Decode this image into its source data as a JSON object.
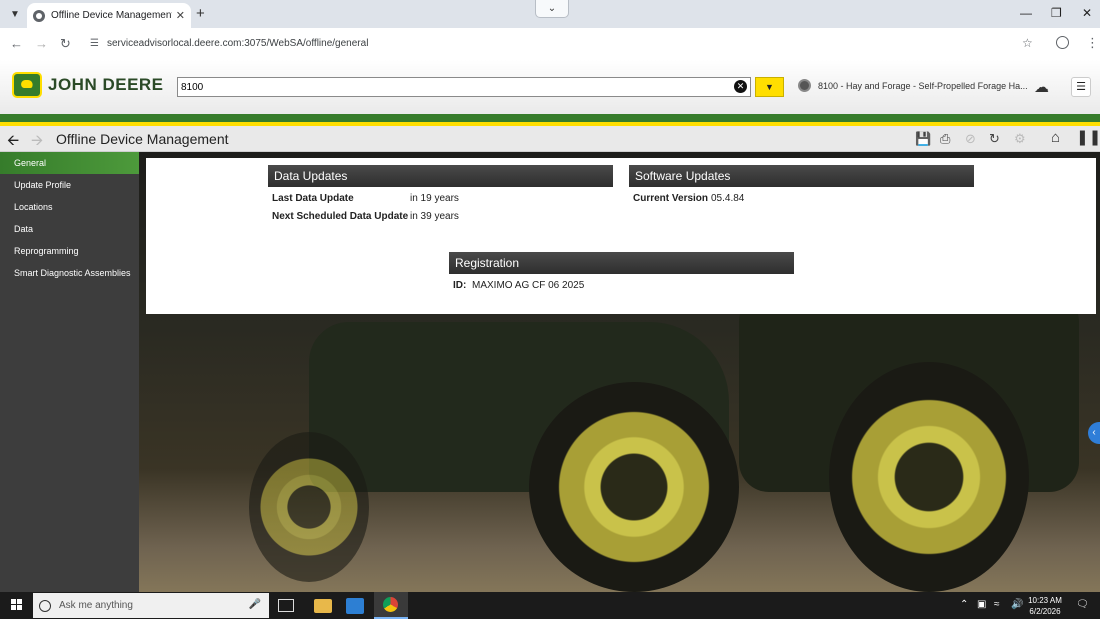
{
  "browser": {
    "tab_title": "Offline Device Management :: S",
    "url": "serviceadvisorlocal.deere.com:3075/WebSA/offline/general"
  },
  "header": {
    "brand": "JOHN DEERE",
    "search_value": "8100",
    "machine_label": "8100 - Hay and Forage - Self-Propelled Forage Ha..."
  },
  "page": {
    "title": "Offline Device Management"
  },
  "sidebar": {
    "items": [
      {
        "label": "General",
        "active": true
      },
      {
        "label": "Update Profile",
        "active": false
      },
      {
        "label": "Locations",
        "active": false
      },
      {
        "label": "Data",
        "active": false
      },
      {
        "label": "Reprogramming",
        "active": false
      },
      {
        "label": "Smart Diagnostic Assemblies",
        "active": false
      }
    ]
  },
  "data_updates": {
    "heading": "Data Updates",
    "last_label": "Last Data Update",
    "last_value": "in 19 years",
    "next_label": "Next Scheduled Data Update",
    "next_value": "in 39 years"
  },
  "software_updates": {
    "heading": "Software Updates",
    "version_label": "Current Version",
    "version_value": "05.4.84"
  },
  "registration": {
    "heading": "Registration",
    "id_label": "ID:",
    "id_value": "MAXIMO AG CF 06 2025"
  },
  "taskbar": {
    "search_placeholder": "Ask me anything",
    "time": "10:23 AM",
    "date": "6/2/2026"
  },
  "colors": {
    "brand_green": "#367c2b",
    "brand_yellow": "#ffde00",
    "section_header": "#3a3a3a"
  }
}
